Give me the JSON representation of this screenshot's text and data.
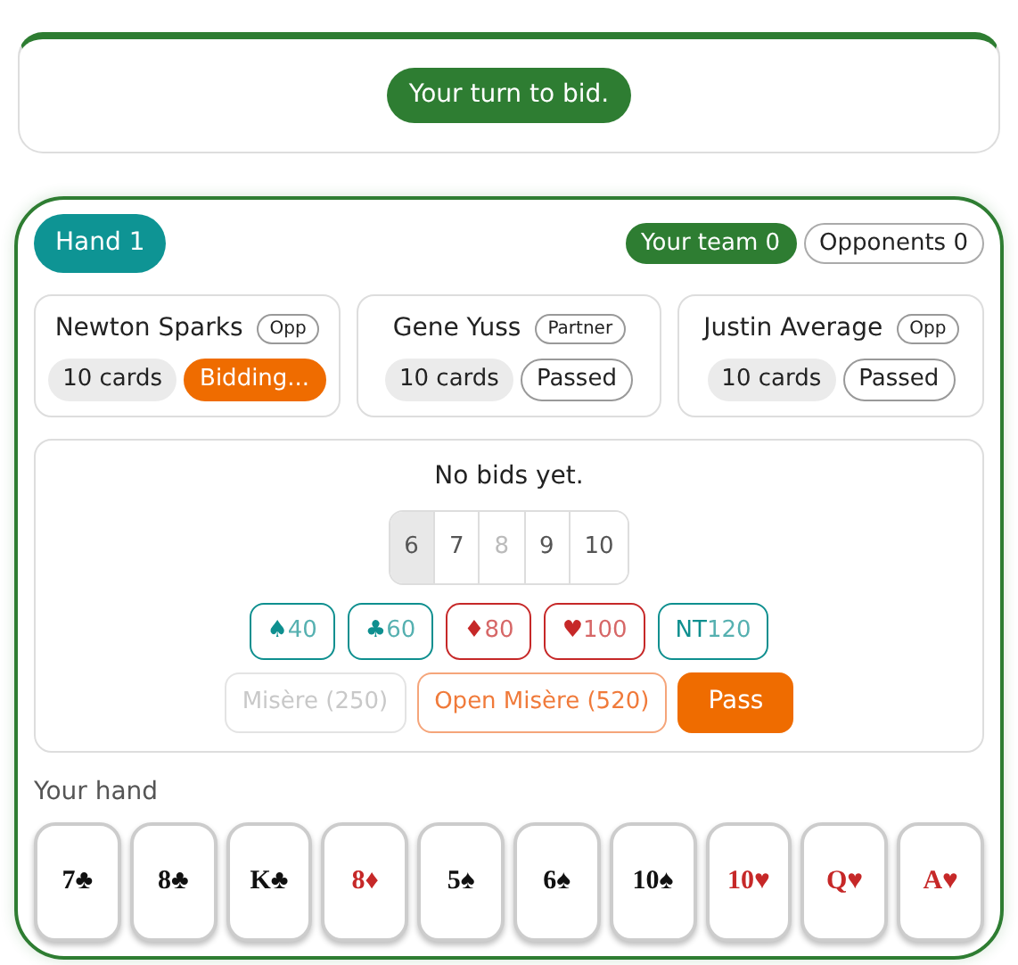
{
  "status": {
    "message": "Your turn to bid."
  },
  "hand_label": "Hand 1",
  "scores": [
    {
      "label": "Your team 0",
      "kind": "team"
    },
    {
      "label": "Opponents 0",
      "kind": "opponents"
    }
  ],
  "players": [
    {
      "name": "Newton Sparks",
      "role": "Opp",
      "cards": "10 cards",
      "status": "Bidding...",
      "active": true
    },
    {
      "name": "Gene Yuss",
      "role": "Partner",
      "cards": "10 cards",
      "status": "Passed",
      "active": false
    },
    {
      "name": "Justin Average",
      "role": "Opp",
      "cards": "10 cards",
      "status": "Passed",
      "active": false
    }
  ],
  "bidding": {
    "message": "No bids yet.",
    "levels": [
      {
        "label": "6",
        "selected": true,
        "disabled": false
      },
      {
        "label": "7",
        "selected": false,
        "disabled": false
      },
      {
        "label": "8",
        "selected": false,
        "disabled": true
      },
      {
        "label": "9",
        "selected": false,
        "disabled": false
      },
      {
        "label": "10",
        "selected": false,
        "disabled": false
      }
    ],
    "suits": [
      {
        "symbol": "♠",
        "points": "40",
        "color": "#0e8f8f"
      },
      {
        "symbol": "♣",
        "points": "60",
        "color": "#0e8f8f"
      },
      {
        "symbol": "♦",
        "points": "80",
        "color": "#c62828"
      },
      {
        "symbol": "♥",
        "points": "100",
        "color": "#c62828"
      },
      {
        "symbol": "NT",
        "points": "120",
        "color": "#0e8f8f"
      }
    ],
    "specials": [
      {
        "label": "Misère (250)",
        "kind": "misere",
        "disabled": true
      },
      {
        "label": "Open Misère (520)",
        "kind": "open",
        "disabled": false
      },
      {
        "label": "Pass",
        "kind": "pass",
        "disabled": false
      }
    ]
  },
  "hand": {
    "title": "Your hand",
    "cards": [
      {
        "label": "7♣",
        "color": "#111111"
      },
      {
        "label": "8♣",
        "color": "#111111"
      },
      {
        "label": "K♣",
        "color": "#111111"
      },
      {
        "label": "8♦",
        "color": "#c62828"
      },
      {
        "label": "5♠",
        "color": "#111111"
      },
      {
        "label": "6♠",
        "color": "#111111"
      },
      {
        "label": "10♠",
        "color": "#111111"
      },
      {
        "label": "10♥",
        "color": "#c62828"
      },
      {
        "label": "Q♥",
        "color": "#c62828"
      },
      {
        "label": "A♥",
        "color": "#c62828"
      }
    ]
  }
}
